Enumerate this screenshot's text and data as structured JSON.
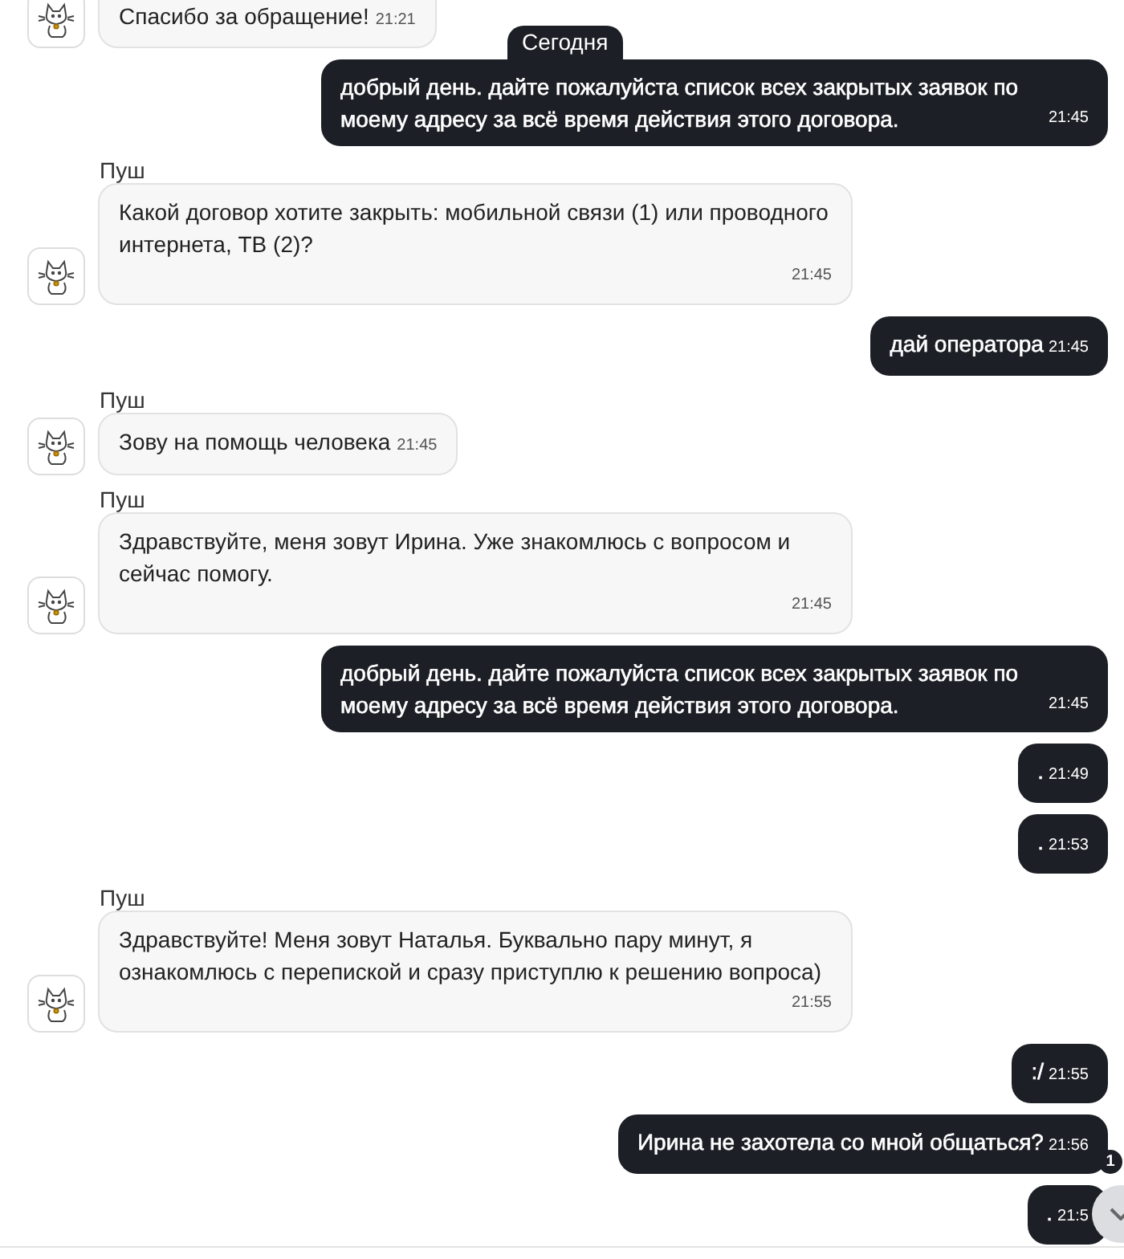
{
  "date_badge": "Сегодня",
  "messages": [
    {
      "kind": "incoming",
      "text": "Спасибо за обращение!",
      "time": "21:21"
    },
    {
      "kind": "outgoing",
      "text": "добрый день. дайте пожалуйста список всех закрытых заявок по моему адресу за всё время действия этого договора.",
      "time": "21:45"
    },
    {
      "kind": "incoming",
      "sender": "Пуш",
      "text": "Какой договор хотите закрыть: мобильной связи (1) или проводного интернета, ТВ (2)?",
      "time": "21:45"
    },
    {
      "kind": "outgoing",
      "text": "дай оператора",
      "time": "21:45"
    },
    {
      "kind": "incoming",
      "sender": "Пуш",
      "text": "Зову на помощь человека",
      "time": "21:45"
    },
    {
      "kind": "incoming",
      "sender": "Пуш",
      "text": "Здравствуйте, меня зовут Ирина. Уже знакомлюсь с вопросом и сейчас помогу.",
      "time": "21:45"
    },
    {
      "kind": "outgoing",
      "text": "добрый день. дайте пожалуйста список всех закрытых заявок по моему адресу за всё время действия этого договора.",
      "time": "21:45"
    },
    {
      "kind": "outgoing",
      "text": ".",
      "time": "21:49"
    },
    {
      "kind": "outgoing",
      "text": ".",
      "time": "21:53"
    },
    {
      "kind": "incoming",
      "sender": "Пуш",
      "text": "Здравствуйте! Меня зовут Наталья. Буквально пару минут, я ознакомлюсь с перепиской и сразу приступлю к решению вопроса)",
      "time": "21:55"
    },
    {
      "kind": "outgoing",
      "text": ":/",
      "time": "21:55"
    },
    {
      "kind": "outgoing",
      "text": "Ирина не захотела со мной общаться?",
      "time": "21:56"
    },
    {
      "kind": "outgoing",
      "text": ".",
      "time": "21:5"
    }
  ],
  "scroll_button": {
    "badge": "1"
  }
}
